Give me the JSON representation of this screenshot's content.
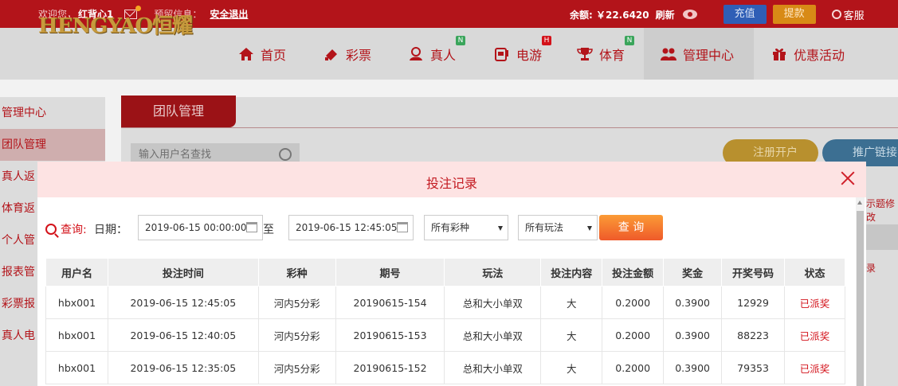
{
  "topbar": {
    "welcome_label": "欢迎您，",
    "username": "红背心1",
    "preview_label": "预留信息：",
    "logout_label": "安全退出",
    "balance_label": "余额: ￥22.6420",
    "refresh_label": "刷新",
    "recharge_label": "充值",
    "withdraw_label": "提款",
    "service_label": "客服"
  },
  "logo_text": "HENGYAO恒耀",
  "nav": {
    "items": [
      {
        "label": "首页",
        "icon": "home-icon"
      },
      {
        "label": "彩票",
        "icon": "lottery-icon"
      },
      {
        "label": "真人",
        "icon": "live-dealer-icon",
        "badge": "N"
      },
      {
        "label": "电游",
        "icon": "slot-machine-icon",
        "badge": "H"
      },
      {
        "label": "体育",
        "icon": "trophy-icon",
        "badge": "N"
      },
      {
        "label": "管理中心",
        "icon": "users-icon"
      },
      {
        "label": "优惠活动",
        "icon": "gift-icon"
      }
    ]
  },
  "sidebar": {
    "items": [
      {
        "label": "管理中心"
      },
      {
        "label": "团队管理"
      },
      {
        "label": "真人返"
      },
      {
        "label": "体育返"
      },
      {
        "label": "个人管"
      },
      {
        "label": "报表管"
      },
      {
        "label": "彩票报"
      },
      {
        "label": "真人电"
      }
    ]
  },
  "content": {
    "tab_label": "团队管理",
    "search_placeholder": "输入用户名查找",
    "register_label": "注册开户",
    "promo_label": "推广链接",
    "right_text1": "示题修改",
    "right_text2": "录"
  },
  "modal": {
    "title": "投注记录",
    "query_label": "查询:",
    "date_label": "日期：",
    "date_from": "2019-06-15 00:00:00",
    "to_label": "至",
    "date_to": "2019-06-15 12:45:05",
    "lottery_select": "所有彩种",
    "play_select": "所有玩法",
    "search_button": "查 询",
    "columns": [
      "用户名",
      "投注时间",
      "彩种",
      "期号",
      "玩法",
      "投注内容",
      "投注金额",
      "奖金",
      "开奖号码",
      "状态"
    ],
    "rows": [
      [
        "hbx001",
        "2019-06-15 12:45:05",
        "河内5分彩",
        "20190615-154",
        "总和大小单双",
        "大",
        "0.2000",
        "0.3900",
        "12929",
        "已派奖"
      ],
      [
        "hbx001",
        "2019-06-15 12:40:05",
        "河内5分彩",
        "20190615-153",
        "总和大小单双",
        "大",
        "0.2000",
        "0.3900",
        "88223",
        "已派奖"
      ],
      [
        "hbx001",
        "2019-06-15 12:35:05",
        "河内5分彩",
        "20190615-152",
        "总和大小单双",
        "大",
        "0.2000",
        "0.3900",
        "79353",
        "已派奖"
      ]
    ]
  },
  "colors": {
    "brand_red": "#b3141a",
    "modal_header": "#fde3e3",
    "search_button": "#f27a2e",
    "status_red": "#d3121a"
  }
}
